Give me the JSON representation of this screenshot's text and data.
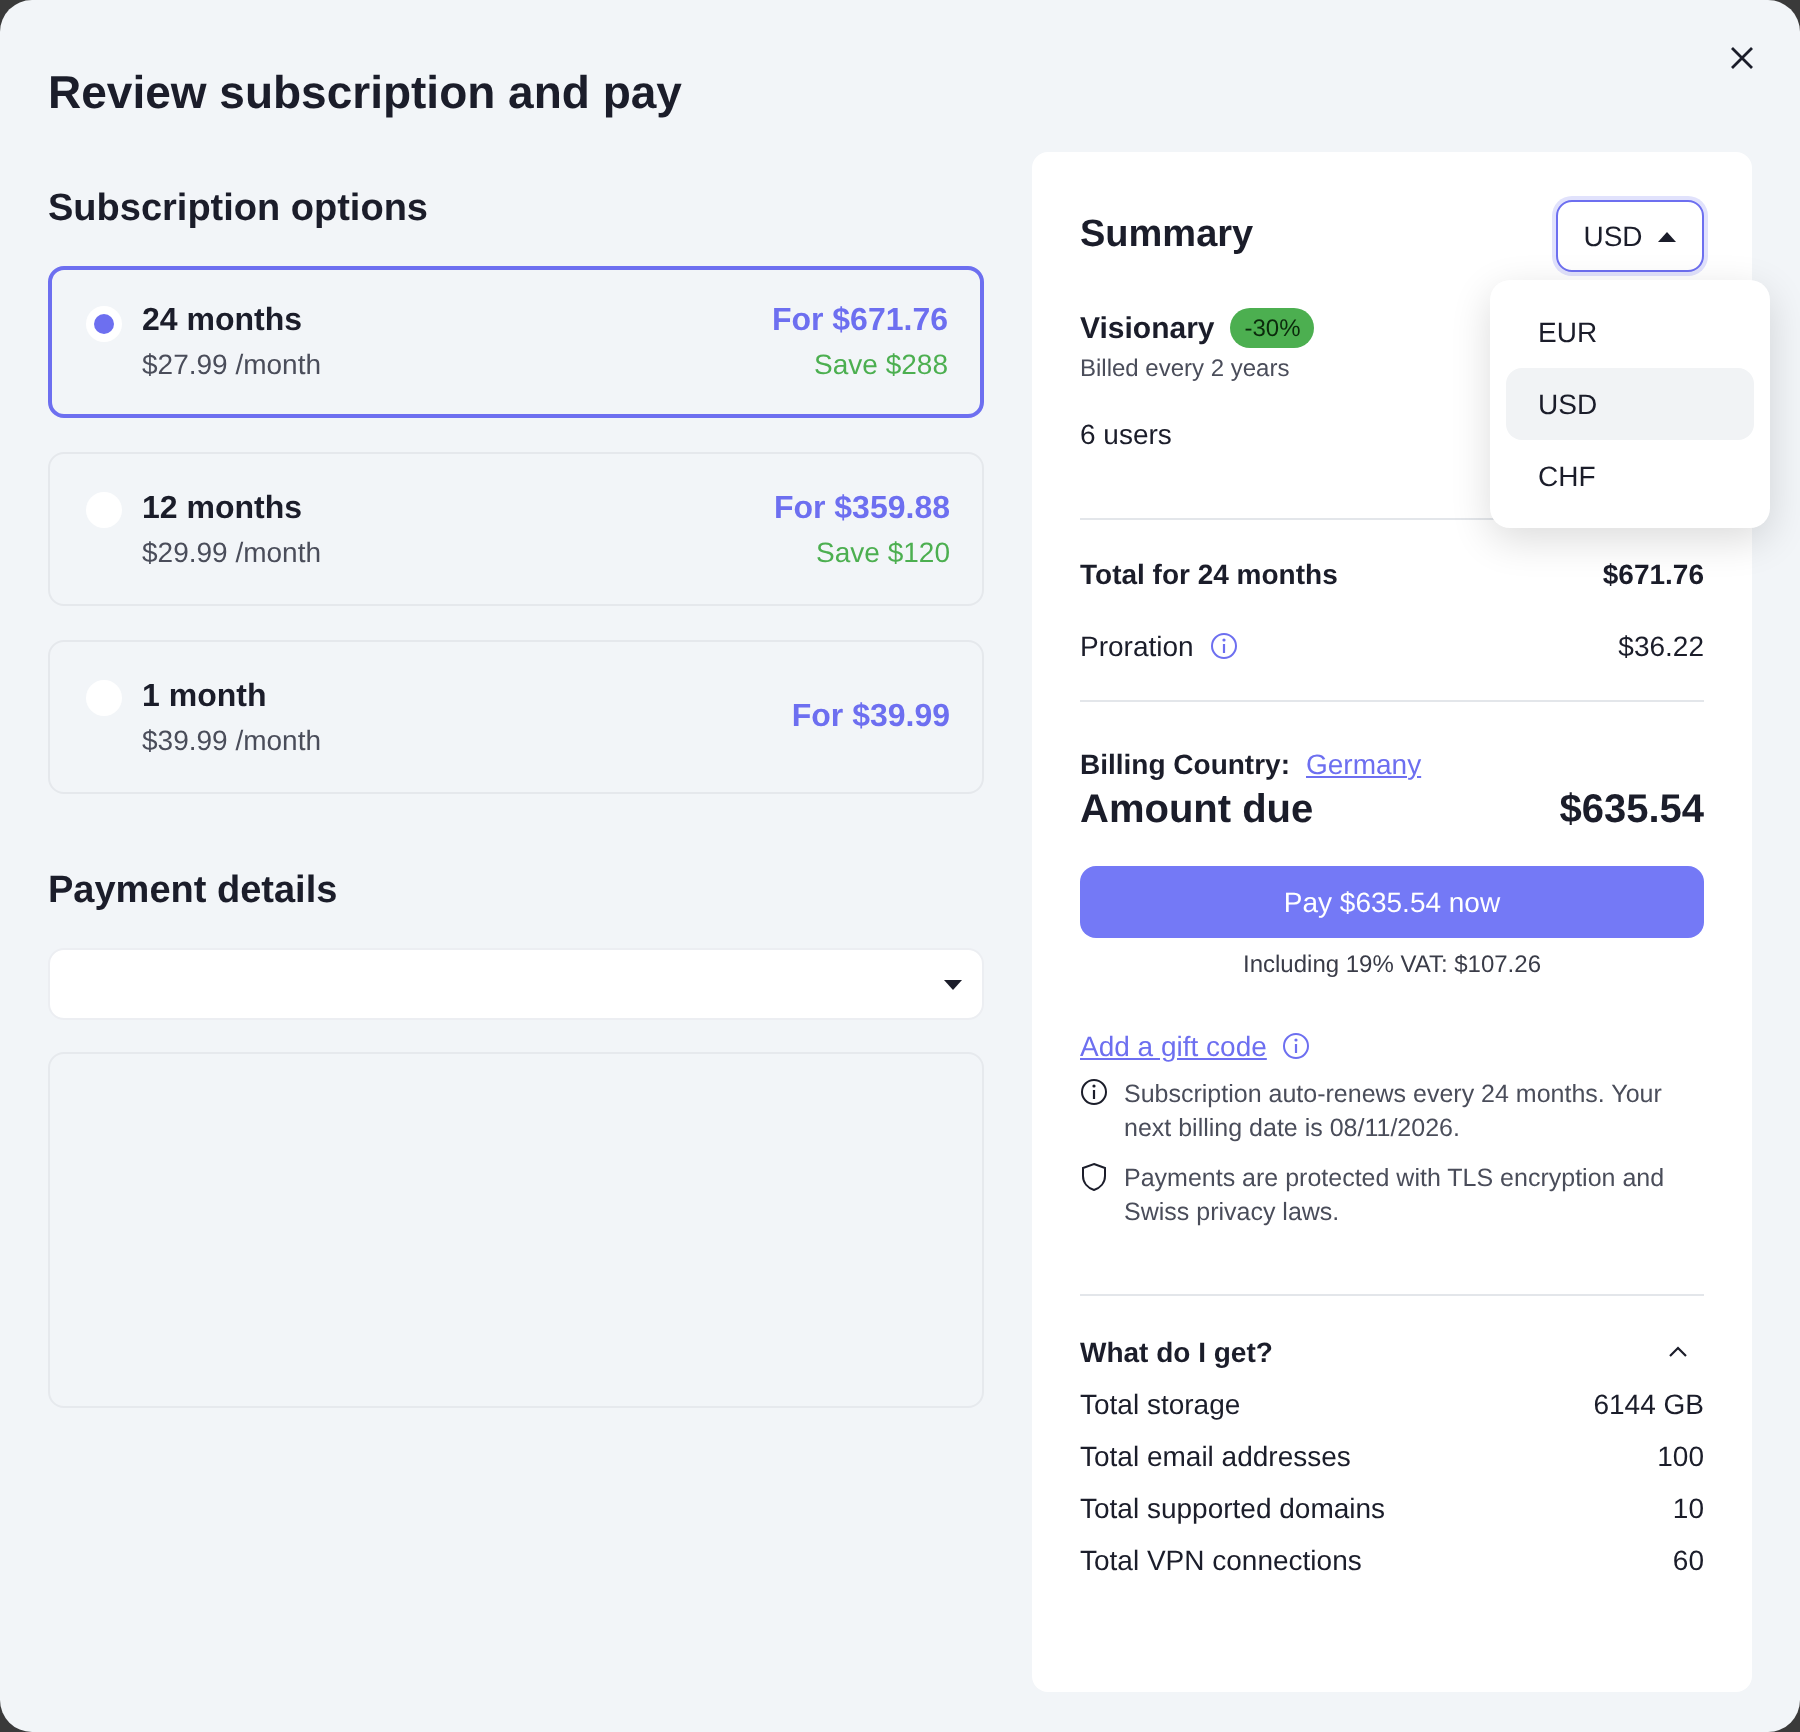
{
  "dialog": {
    "title": "Review subscription and pay"
  },
  "subscription": {
    "heading": "Subscription options",
    "options": [
      {
        "duration": "24 months",
        "monthly": "$27.99 /month",
        "total": "For $671.76",
        "saving": "Save $288",
        "selected": true
      },
      {
        "duration": "12 months",
        "monthly": "$29.99 /month",
        "total": "For $359.88",
        "saving": "Save $120",
        "selected": false
      },
      {
        "duration": "1 month",
        "monthly": "$39.99 /month",
        "total": "For $39.99",
        "selected": false
      }
    ]
  },
  "payment": {
    "heading": "Payment details"
  },
  "summary": {
    "title": "Summary",
    "currency": {
      "value": "USD",
      "expanded": true,
      "options": [
        {
          "label": "EUR",
          "selected": false
        },
        {
          "label": "USD",
          "selected": true
        },
        {
          "label": "CHF",
          "selected": false
        }
      ]
    },
    "plan": {
      "name": "Visionary",
      "discount": "-30%",
      "billing": "Billed every 2 years"
    },
    "users": "6 users",
    "lines": [
      {
        "label": "Total for 24 months",
        "value": "$671.76",
        "info": false
      },
      {
        "label": "Proration",
        "value": "$36.22",
        "info": true
      }
    ],
    "billing_country": {
      "label": "Billing Country:",
      "value": "Germany"
    },
    "amount_due": {
      "label": "Amount due",
      "value": "$635.54"
    },
    "pay_button": "Pay $635.54 now",
    "vat": "Including 19% VAT: $107.26",
    "gift_code": "Add a gift code",
    "notes": [
      {
        "kind": "info",
        "text": "Subscription auto-renews every 24 months. Your next billing date is 08/11/2026."
      },
      {
        "kind": "shield",
        "text": "Payments are protected with TLS encryption and Swiss privacy laws."
      }
    ],
    "features": {
      "title": "What do I get?",
      "expanded": true,
      "rows": [
        {
          "label": "Total storage",
          "value": "6144 GB"
        },
        {
          "label": "Total email addresses",
          "value": "100"
        },
        {
          "label": "Total supported domains",
          "value": "10"
        },
        {
          "label": "Total VPN connections",
          "value": "60"
        }
      ]
    }
  }
}
